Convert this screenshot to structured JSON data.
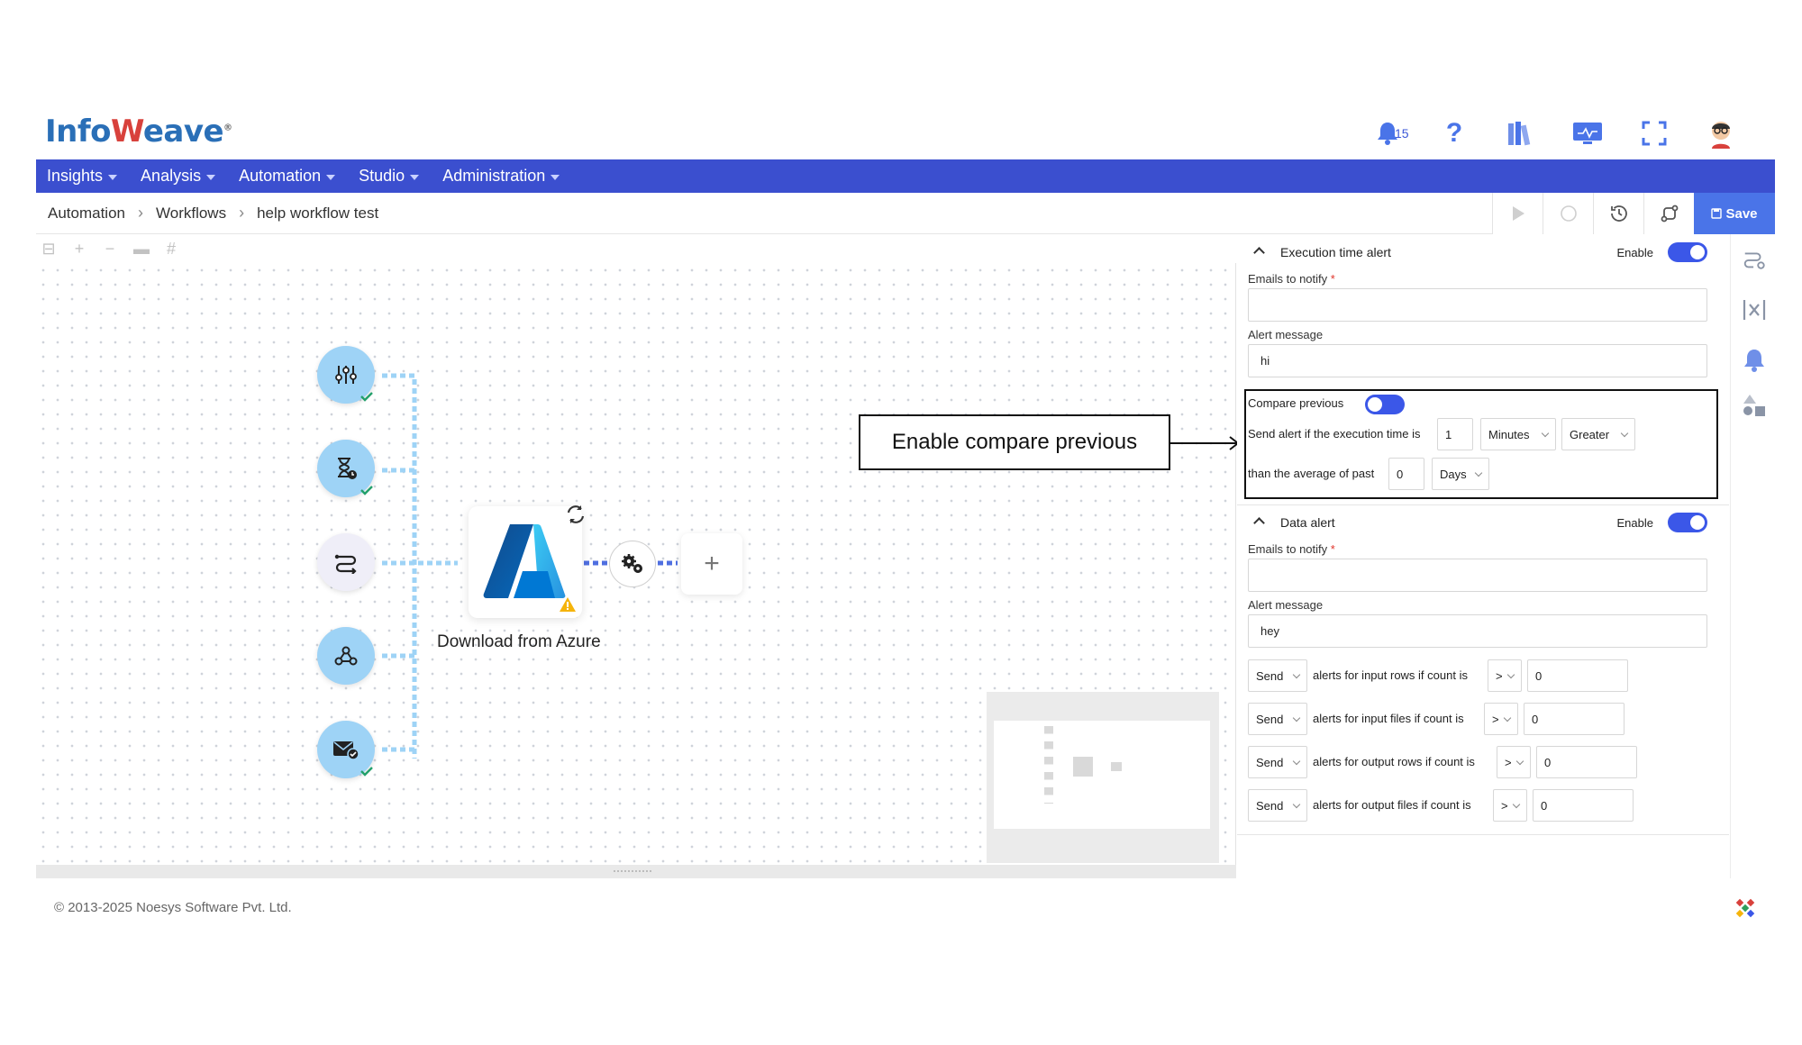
{
  "app": {
    "logo_text_a": "Info",
    "logo_text_b": "eave",
    "logo_mark": "®"
  },
  "header": {
    "notification_count": "15"
  },
  "nav": [
    {
      "label": "Insights"
    },
    {
      "label": "Analysis"
    },
    {
      "label": "Automation"
    },
    {
      "label": "Studio"
    },
    {
      "label": "Administration"
    }
  ],
  "breadcrumb": [
    "Automation",
    "Workflows",
    "help workflow test"
  ],
  "toolbar": {
    "save_label": "Save"
  },
  "canvas": {
    "azure_node_label": "Download from Azure",
    "plus_label": "+"
  },
  "annotation": {
    "text": "Enable compare previous"
  },
  "execution_alert": {
    "title": "Execution time alert",
    "enable_label": "Enable",
    "enabled": true,
    "emails_label": "Emails to notify",
    "required_mark": "*",
    "emails_value": "",
    "message_label": "Alert message",
    "message_value": "hi",
    "compare_label": "Compare previous",
    "compare_enabled": false,
    "send_if_label": "Send alert if the execution time is",
    "time_value": "1",
    "unit_value": "Minutes",
    "comparison_value": "Greater",
    "than_avg_label": "than the average of past",
    "past_value": "0",
    "past_unit": "Days"
  },
  "data_alert": {
    "title": "Data alert",
    "enable_label": "Enable",
    "enabled": true,
    "emails_label": "Emails to notify",
    "required_mark": "*",
    "emails_value": "",
    "message_label": "Alert message",
    "message_value": "hey",
    "rules": [
      {
        "action": "Send",
        "text": "alerts for input rows  if count is",
        "op": ">",
        "value": "0"
      },
      {
        "action": "Send",
        "text": "alerts for input files  if count is",
        "op": ">",
        "value": "0"
      },
      {
        "action": "Send",
        "text": "alerts for output rows  if count is",
        "op": ">",
        "value": "0"
      },
      {
        "action": "Send",
        "text": "alerts for output files  if count is",
        "op": ">",
        "value": "0"
      }
    ]
  },
  "footer": {
    "copyright": "© 2013-2025 Noesys Software Pvt. Ltd."
  },
  "colors": {
    "nav_bg": "#3b4fcf",
    "accent": "#3b57e8",
    "save_bg": "#4a74e8",
    "node_bg": "#9ed3f6"
  }
}
